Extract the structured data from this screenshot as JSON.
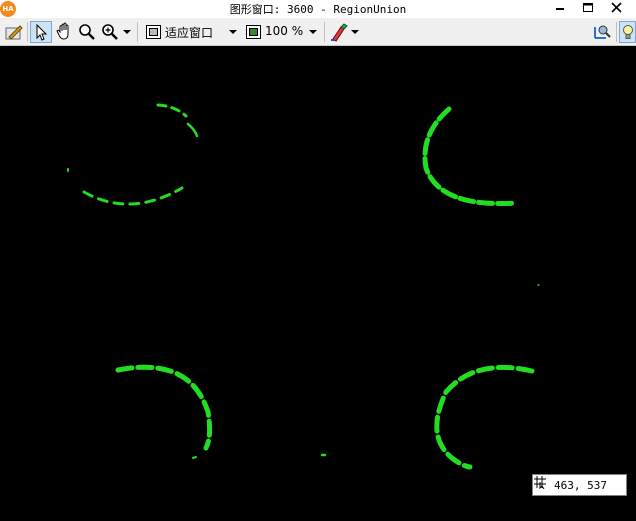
{
  "window": {
    "logo_text": "HA",
    "title": "图形窗口: 3600 - RegionUnion"
  },
  "toolbar": {
    "fit_label": "适应窗口",
    "zoom_value": "100 %"
  },
  "canvas": {
    "background": "#000000",
    "region_color": "#22dd22"
  },
  "coordinates": {
    "readout": "463, 537"
  },
  "icons": {
    "app": "halcon-logo",
    "edit": "pencil-icon",
    "pointer": "arrow-pointer-icon",
    "pan": "hand-icon",
    "magnify": "magnifier-icon",
    "zoom": "zoom-in-icon",
    "fit": "fit-window-icon",
    "zoom_combo": "image-zoom-icon",
    "color": "color-brush-icon",
    "inspect": "inspect-icon",
    "lamp": "lightbulb-icon",
    "crosshair": "crosshair-cursor-icon"
  }
}
